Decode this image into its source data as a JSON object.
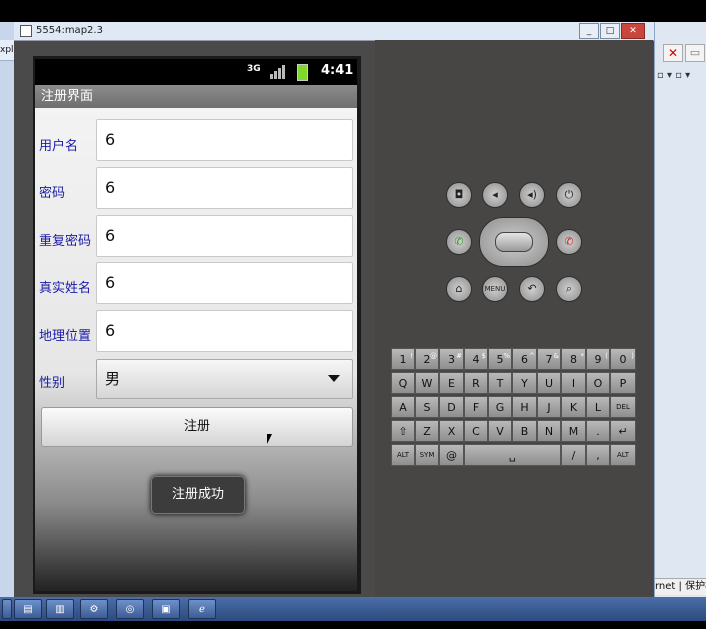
{
  "window": {
    "title": "5554:map2.3",
    "min": "_",
    "max": "□",
    "close": "✕"
  },
  "desktop": {
    "left_strip": "xpl",
    "status_text": "rnet | 保护模"
  },
  "phone": {
    "status": {
      "net": "3G",
      "time": "4:41"
    },
    "app_title": "注册界面",
    "fields": [
      {
        "label": "用户名",
        "value": "6"
      },
      {
        "label": "密码",
        "value": "6"
      },
      {
        "label": "重复密码",
        "value": "6"
      },
      {
        "label": "真实姓名",
        "value": "6"
      },
      {
        "label": "地理位置",
        "value": "6"
      }
    ],
    "gender": {
      "label": "性别",
      "value": "男"
    },
    "register_label": "注册",
    "toast": "注册成功"
  },
  "controls": {
    "menu": "MENU"
  },
  "keyboard": {
    "row1": [
      "1",
      "2",
      "3",
      "4",
      "5",
      "6",
      "7",
      "8",
      "9",
      "0"
    ],
    "row1_sub": [
      "!",
      "@",
      "#",
      "$",
      "%",
      "^",
      "&",
      "*",
      "(",
      ")"
    ],
    "row2": [
      "Q",
      "W",
      "E",
      "R",
      "T",
      "Y",
      "U",
      "I",
      "O",
      "P"
    ],
    "row3": [
      "A",
      "S",
      "D",
      "F",
      "G",
      "H",
      "J",
      "K",
      "L",
      "DEL"
    ],
    "row4": [
      "⇧",
      "Z",
      "X",
      "C",
      "V",
      "B",
      "N",
      "M",
      ".",
      "↵"
    ],
    "row5": {
      "alt": "ALT",
      "sym": "SYM",
      "at": "@",
      "slash": "/",
      "comma": ",",
      "alt2": "ALT"
    }
  }
}
